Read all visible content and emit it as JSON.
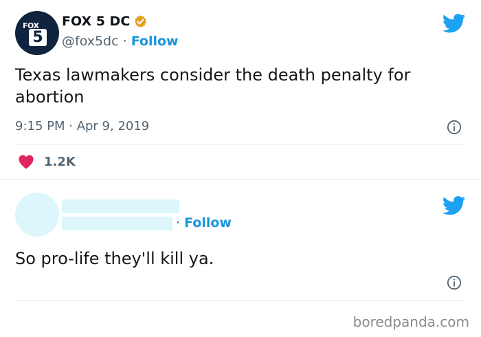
{
  "tweet1": {
    "avatar_text": "FOX",
    "avatar_number": "5",
    "display_name": "FOX 5 DC",
    "handle": "@fox5dc",
    "separator": "·",
    "follow_label": "Follow",
    "text": "Texas lawmakers consider the death penalty for abortion",
    "timestamp": "9:15 PM · Apr 9, 2019",
    "like_count": "1.2K"
  },
  "tweet2": {
    "separator": "·",
    "follow_label": "Follow",
    "text": "So pro-life they'll kill ya."
  },
  "watermark": "boredpanda.com",
  "colors": {
    "twitter_blue": "#1da1f2",
    "follow_blue": "#1b95e0",
    "heart_pink": "#e0245e",
    "verified_gold": "#e2a31f",
    "redacted_cyan": "#dcf6fb",
    "fox_navy": "#10243f"
  },
  "icons": [
    "verified-badge-icon",
    "twitter-bird-icon",
    "info-icon",
    "heart-icon"
  ]
}
